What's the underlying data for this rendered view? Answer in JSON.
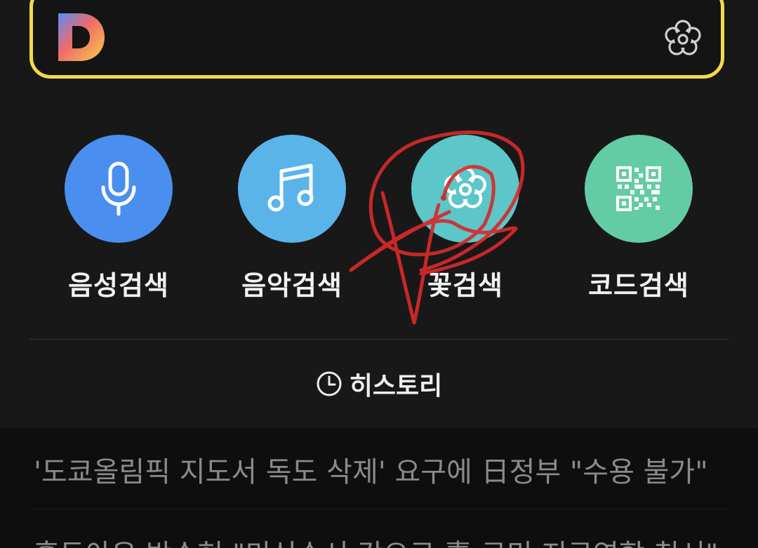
{
  "search": {
    "logo_letter": "D",
    "logo_icon": "daum-logo-icon",
    "flower_icon": "flower-icon"
  },
  "quick_actions": [
    {
      "label": "음성검색",
      "icon": "microphone-icon",
      "color": "#4a8ff0"
    },
    {
      "label": "음악검색",
      "icon": "music-note-icon",
      "color": "#5ab4ea"
    },
    {
      "label": "꽃검색",
      "icon": "flower-icon",
      "color": "#5cc6c8"
    },
    {
      "label": "코드검색",
      "icon": "qr-code-icon",
      "color": "#64cca4"
    }
  ],
  "history": {
    "label": "히스토리",
    "icon": "clock-icon"
  },
  "news": [
    "'도쿄올림픽 지도서 독도 삭제' 요구에 日정부 \"수용 불가\"",
    "홍두아은 박수현 \"미신수서 강으로 靑 구민 지구역할 칙서\""
  ],
  "colors": {
    "accent_border": "#f2d94e",
    "annotation": "#d62a2a"
  }
}
